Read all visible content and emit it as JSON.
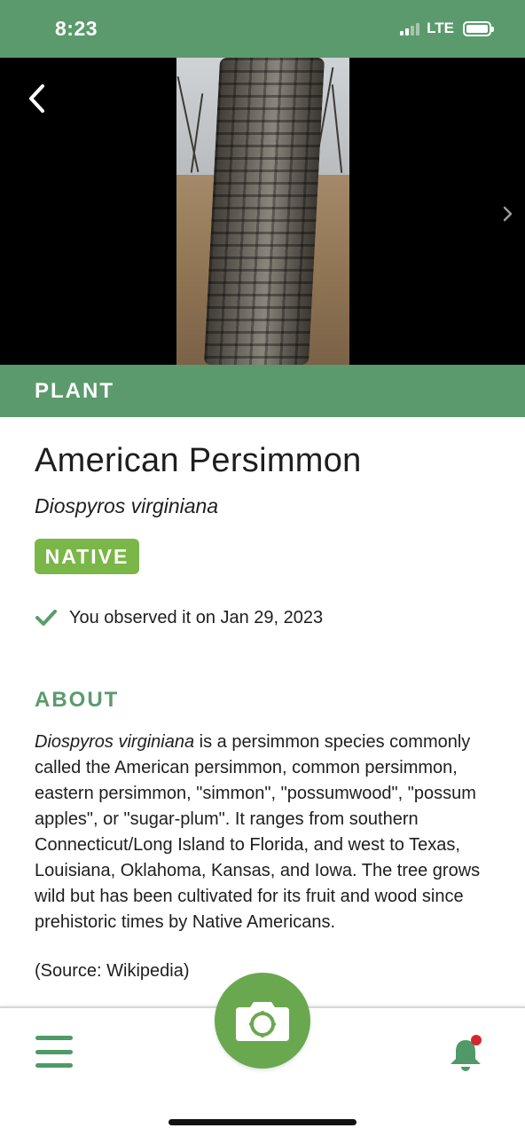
{
  "status_bar": {
    "time": "8:23",
    "network": "LTE",
    "signal_bars_active": 2,
    "signal_bars_total": 4
  },
  "photo": {
    "back_icon": "chevron-left-icon",
    "next_icon": "chevron-right-icon"
  },
  "category": "PLANT",
  "species": {
    "common_name": "American Persimmon",
    "scientific_name": "Diospyros virginiana",
    "status_badge": "NATIVE"
  },
  "observation": {
    "icon": "check-icon",
    "text": "You observed it on Jan 29, 2023"
  },
  "about": {
    "heading": "ABOUT",
    "scientific_name": "Diospyros virginiana",
    "text": " is a persimmon species commonly called the American persimmon, common persimmon, eastern persimmon, \"simmon\", \"possumwood\", \"possum apples\", or \"sugar-plum\". It ranges from southern Connecticut/Long Island to Florida, and west to Texas, Louisiana, Oklahoma, Kansas, and Iowa. The tree grows wild but has been cultivated for its fruit and wood since prehistoric times by Native Americans.",
    "source": "(Source: Wikipedia)"
  },
  "bottom_nav": {
    "menu_icon": "hamburger-menu-icon",
    "camera_icon": "camera-icon",
    "notifications_icon": "bell-icon",
    "has_unread_notifications": true
  },
  "colors": {
    "brand_green": "#5b9a6c",
    "native_green": "#7ab648",
    "camera_green": "#6aa84f",
    "notification_red": "#d4272d"
  }
}
